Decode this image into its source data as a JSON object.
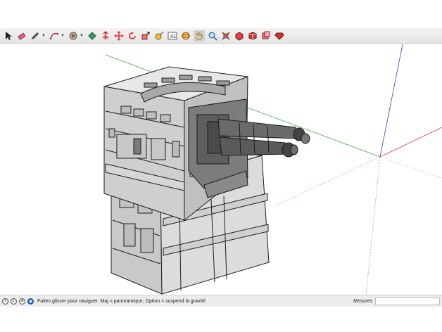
{
  "toolbar": {
    "tools": [
      {
        "name": "select-tool",
        "glyph": "➤",
        "color": "#222222"
      },
      {
        "name": "eraser-tool",
        "glyph": "✎",
        "color": "#d9345f"
      },
      {
        "name": "pencil-tool",
        "glyph": "✏",
        "color": "#333333"
      },
      {
        "name": "arc-tool",
        "glyph": "⌒",
        "color": "#c2185b"
      },
      {
        "name": "shape-tool",
        "glyph": "◉",
        "color": "#7a6a4a"
      },
      {
        "name": "paint-bucket-tool",
        "glyph": "◆",
        "color": "#2f8f5b"
      },
      {
        "name": "push-pull-tool",
        "glyph": "❖",
        "color": "#d32f2f"
      },
      {
        "name": "move-tool",
        "glyph": "✥",
        "color": "#e53935"
      },
      {
        "name": "rotate-tool",
        "glyph": "↻",
        "color": "#e53935"
      },
      {
        "name": "scale-tool",
        "glyph": "⤢",
        "color": "#e53935"
      },
      {
        "name": "tape-measure-tool",
        "glyph": "⚲",
        "color": "#555555"
      },
      {
        "name": "text-tool",
        "glyph": "A",
        "color": "#333333"
      },
      {
        "name": "orbit-tool",
        "glyph": "◎",
        "color": "#c0a020"
      },
      {
        "name": "pan-tool",
        "glyph": "✋",
        "color": "#d2a24c"
      },
      {
        "name": "zoom-tool",
        "glyph": "⚲",
        "color": "#2d6fb8"
      },
      {
        "name": "zoom-extents-tool",
        "glyph": "✕",
        "color": "#c62828"
      },
      {
        "name": "warehouse-tool",
        "glyph": "◈",
        "color": "#c62828"
      },
      {
        "name": "extension-warehouse-tool",
        "glyph": "▣",
        "color": "#c62828"
      },
      {
        "name": "layout-tool",
        "glyph": "◪",
        "color": "#c62828"
      },
      {
        "name": "ruby-tool",
        "glyph": "♦",
        "color": "#c62828"
      }
    ]
  },
  "status": {
    "help_text": "Faites glisser pour naviguer. Maj = panoramique, Option =  suspend la gravité.",
    "mesures_label": "Mesures",
    "mesures_value": ""
  },
  "scene": {
    "axis_colors": {
      "red": "#d94040",
      "green": "#3aa63a",
      "blue": "#3d3dcc"
    }
  }
}
